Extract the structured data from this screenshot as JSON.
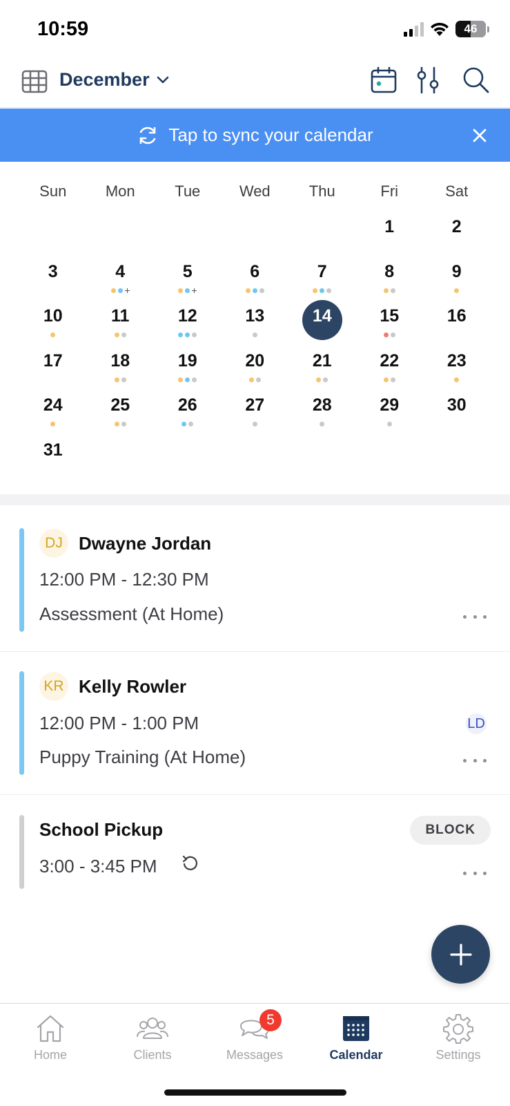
{
  "status_bar": {
    "time": "10:59",
    "battery": "46"
  },
  "header": {
    "month": "December"
  },
  "sync_banner": {
    "text": "Tap to sync your calendar"
  },
  "calendar": {
    "weekdays": [
      "Sun",
      "Mon",
      "Tue",
      "Wed",
      "Thu",
      "Fri",
      "Sat"
    ],
    "selected_day": "14",
    "days": [
      {
        "n": ""
      },
      {
        "n": ""
      },
      {
        "n": ""
      },
      {
        "n": ""
      },
      {
        "n": ""
      },
      {
        "n": "1"
      },
      {
        "n": "2"
      },
      {
        "n": "3"
      },
      {
        "n": "4",
        "dots": [
          "orange",
          "blue",
          "plus"
        ]
      },
      {
        "n": "5",
        "dots": [
          "orange",
          "blue",
          "plus"
        ]
      },
      {
        "n": "6",
        "dots": [
          "orange",
          "blue",
          "gray"
        ]
      },
      {
        "n": "7",
        "dots": [
          "orange",
          "blue",
          "gray"
        ]
      },
      {
        "n": "8",
        "dots": [
          "orange",
          "gray"
        ]
      },
      {
        "n": "9",
        "dots": [
          "orange"
        ]
      },
      {
        "n": "10",
        "dots": [
          "orange"
        ]
      },
      {
        "n": "11",
        "dots": [
          "orange",
          "gray"
        ]
      },
      {
        "n": "12",
        "dots": [
          "blue",
          "blue",
          "gray"
        ]
      },
      {
        "n": "13",
        "dots": [
          "gray"
        ]
      },
      {
        "n": "14"
      },
      {
        "n": "15",
        "dots": [
          "red",
          "gray"
        ]
      },
      {
        "n": "16"
      },
      {
        "n": "17"
      },
      {
        "n": "18",
        "dots": [
          "orange",
          "gray"
        ]
      },
      {
        "n": "19",
        "dots": [
          "orange",
          "blue",
          "gray"
        ]
      },
      {
        "n": "20",
        "dots": [
          "orange",
          "gray"
        ]
      },
      {
        "n": "21",
        "dots": [
          "orange",
          "gray"
        ]
      },
      {
        "n": "22",
        "dots": [
          "orange",
          "gray"
        ]
      },
      {
        "n": "23",
        "dots": [
          "orange"
        ]
      },
      {
        "n": "24",
        "dots": [
          "orange"
        ]
      },
      {
        "n": "25",
        "dots": [
          "orange",
          "gray"
        ]
      },
      {
        "n": "26",
        "dots": [
          "blue",
          "gray"
        ]
      },
      {
        "n": "27",
        "dots": [
          "gray"
        ]
      },
      {
        "n": "28",
        "dots": [
          "gray"
        ]
      },
      {
        "n": "29",
        "dots": [
          "gray"
        ]
      },
      {
        "n": "30"
      },
      {
        "n": "31"
      }
    ]
  },
  "appointments": [
    {
      "initials": "DJ",
      "name": "Dwayne Jordan",
      "time": "12:00 PM - 12:30 PM",
      "service": "Assessment (At Home)",
      "bar_color": "#7cc8f2"
    },
    {
      "initials": "KR",
      "name": "Kelly Rowler",
      "time": "12:00 PM - 1:00 PM",
      "service": "Puppy Training (At Home)",
      "staff": "LD",
      "bar_color": "#7cc8f2"
    },
    {
      "name": "School Pickup",
      "time": "3:00 - 3:45 PM",
      "badge": "BLOCK",
      "bar_color": "#cfcfcf"
    }
  ],
  "nav": {
    "home": "Home",
    "clients": "Clients",
    "messages": "Messages",
    "messages_badge": "5",
    "calendar": "Calendar",
    "settings": "Settings"
  }
}
